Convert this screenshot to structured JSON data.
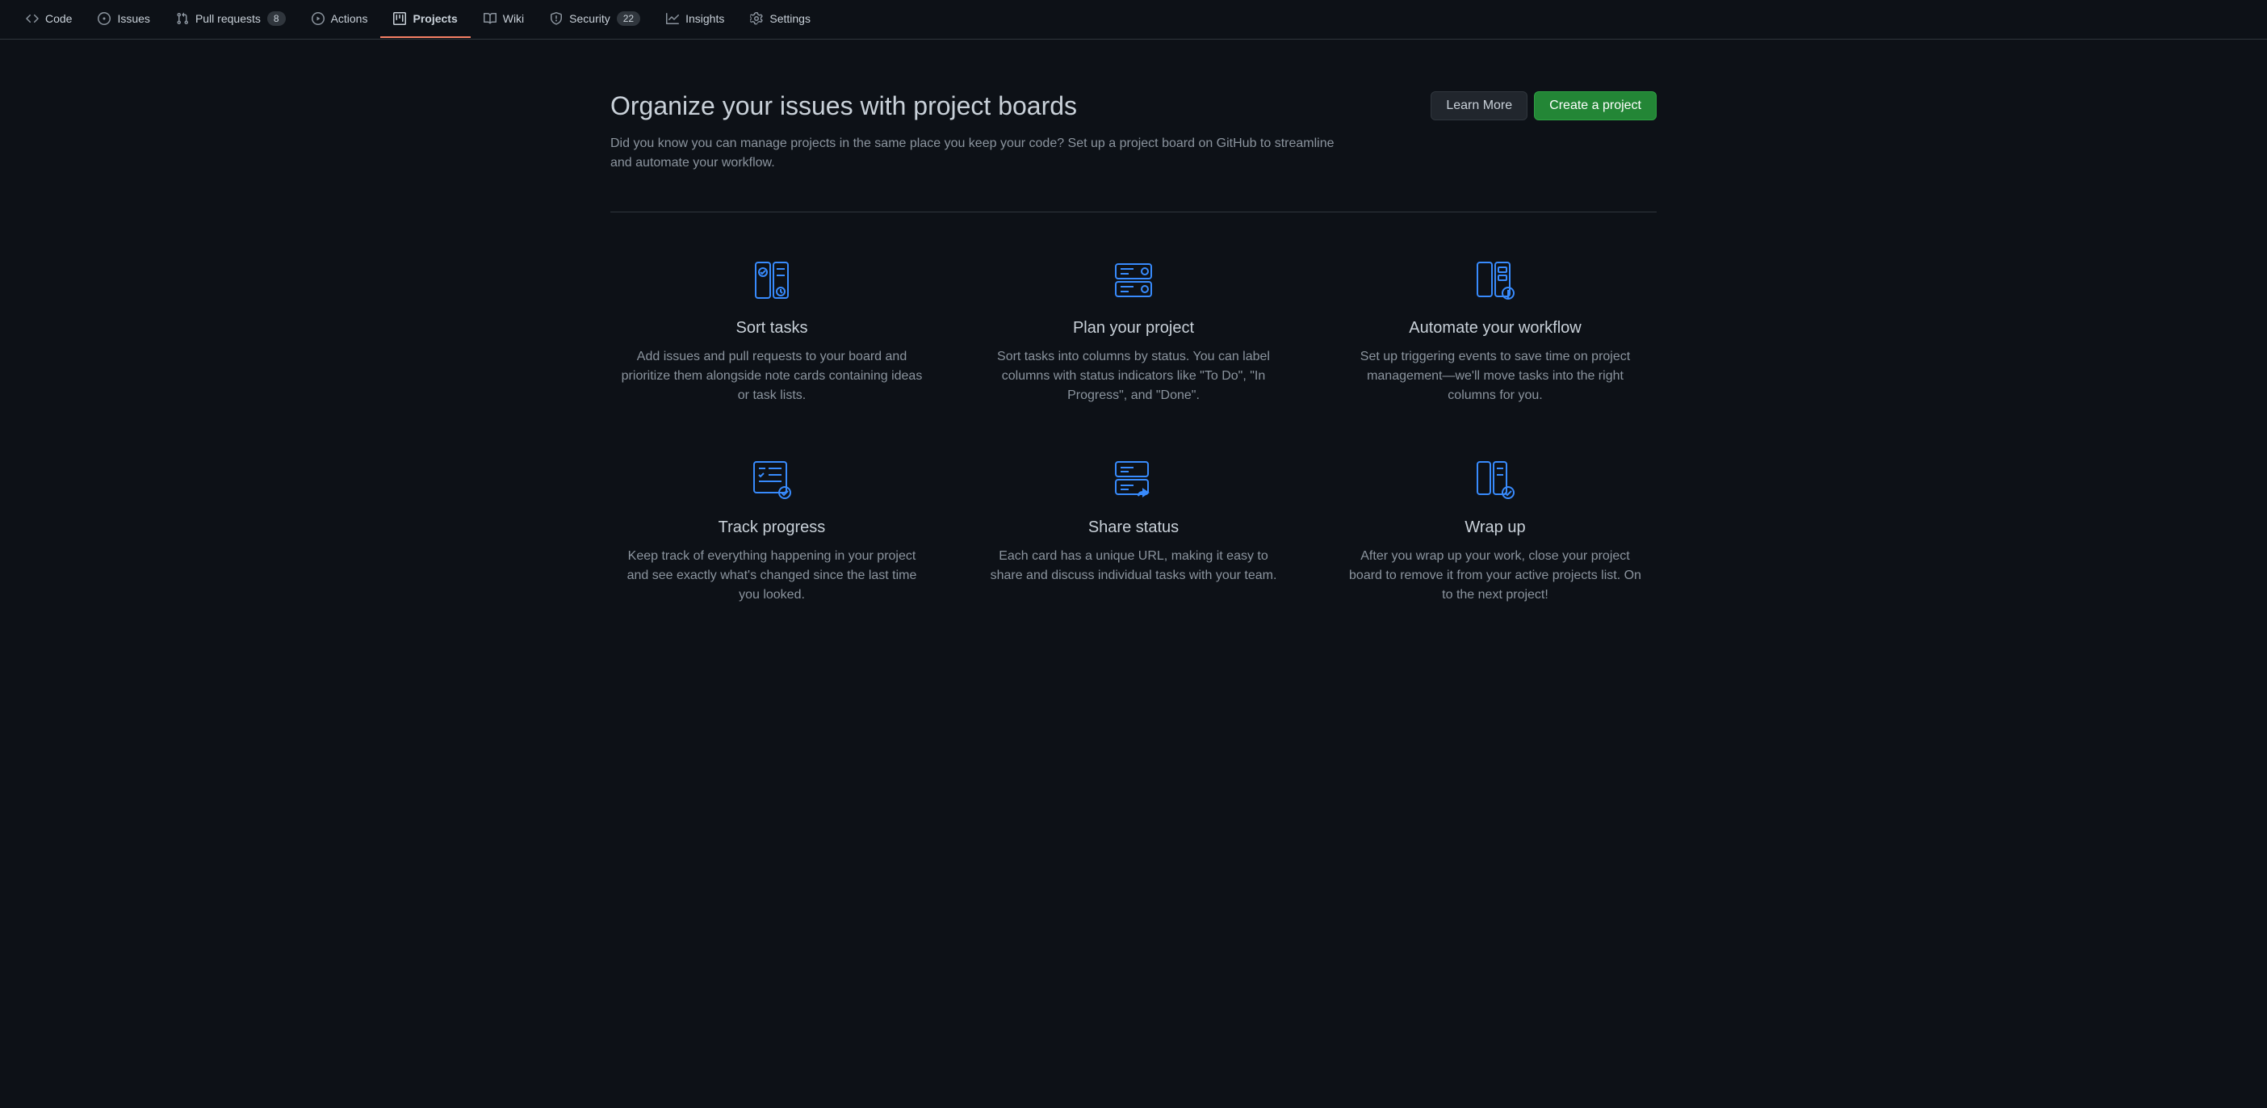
{
  "tabs": {
    "code": "Code",
    "issues": "Issues",
    "pull_requests": "Pull requests",
    "pull_requests_count": "8",
    "actions": "Actions",
    "projects": "Projects",
    "wiki": "Wiki",
    "security": "Security",
    "security_count": "22",
    "insights": "Insights",
    "settings": "Settings"
  },
  "header": {
    "title": "Organize your issues with project boards",
    "subtitle": "Did you know you can manage projects in the same place you keep your code? Set up a project board on GitHub to streamline and automate your workflow."
  },
  "buttons": {
    "learn_more": "Learn More",
    "create_project": "Create a project"
  },
  "features": [
    {
      "title": "Sort tasks",
      "desc": "Add issues and pull requests to your board and prioritize them alongside note cards containing ideas or task lists."
    },
    {
      "title": "Plan your project",
      "desc": "Sort tasks into columns by status. You can label columns with status indicators like \"To Do\", \"In Progress\", and \"Done\"."
    },
    {
      "title": "Automate your workflow",
      "desc": "Set up triggering events to save time on project management—we'll move tasks into the right columns for you."
    },
    {
      "title": "Track progress",
      "desc": "Keep track of everything happening in your project and see exactly what's changed since the last time you looked."
    },
    {
      "title": "Share status",
      "desc": "Each card has a unique URL, making it easy to share and discuss individual tasks with your team."
    },
    {
      "title": "Wrap up",
      "desc": "After you wrap up your work, close your project board to remove it from your active projects list. On to the next project!"
    }
  ]
}
